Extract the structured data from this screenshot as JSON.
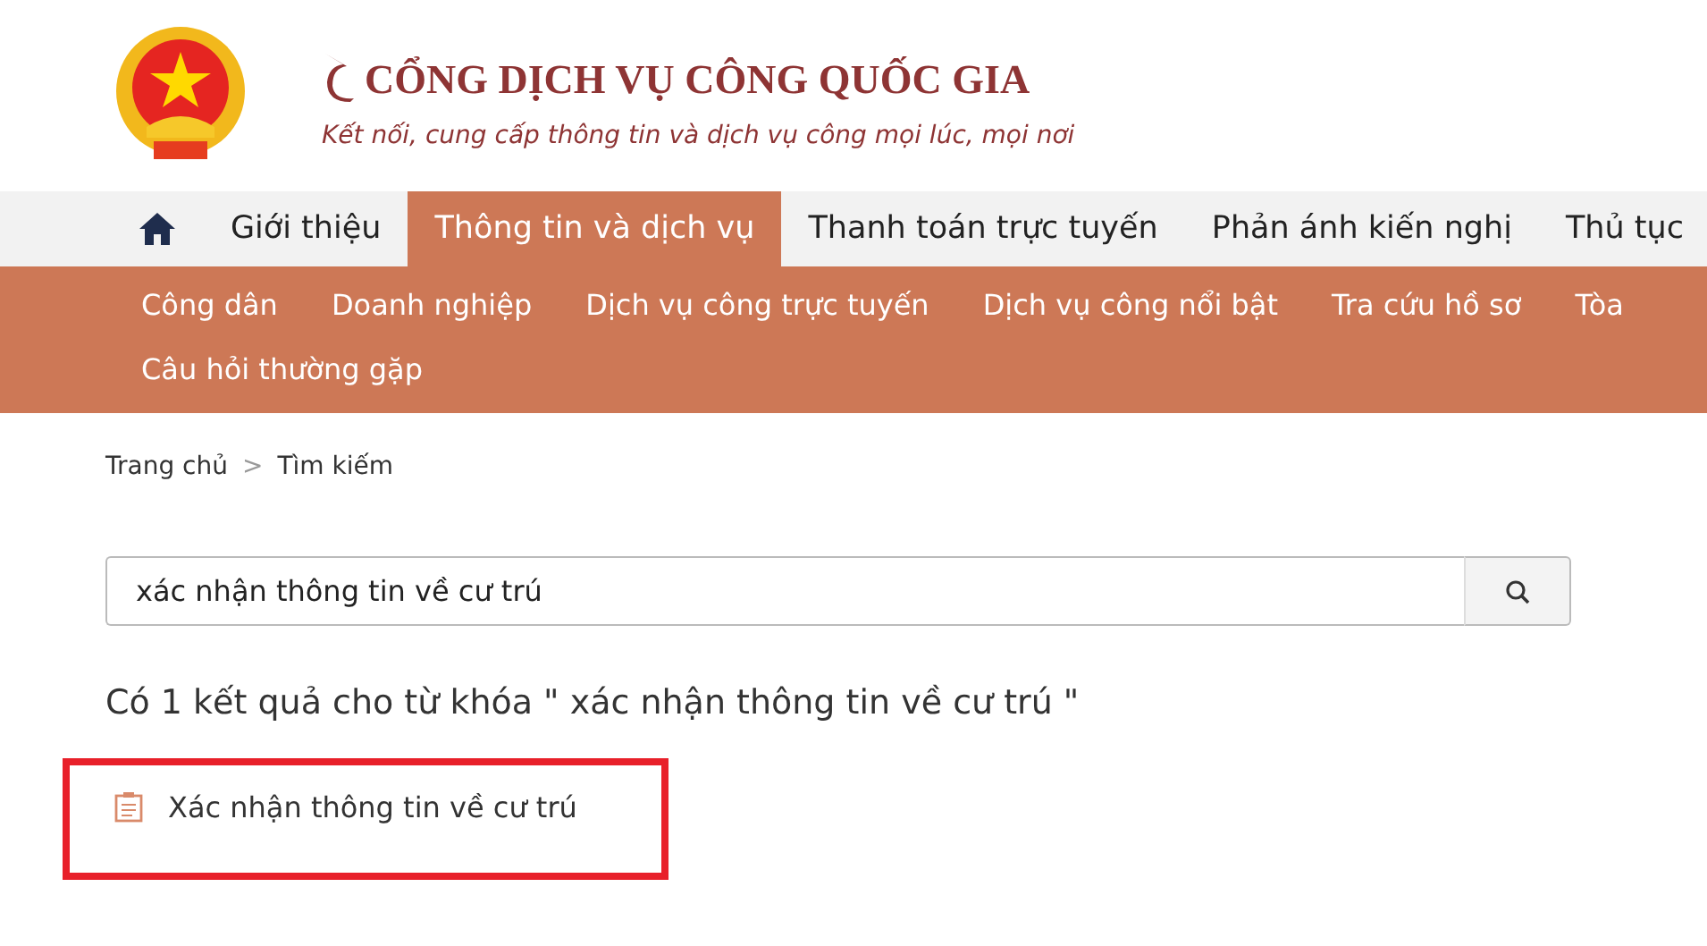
{
  "header": {
    "title": "CỔNG DỊCH VỤ CÔNG QUỐC GIA",
    "tagline": "Kết nối, cung cấp thông tin và dịch vụ công mọi lúc, mọi nơi"
  },
  "nav": [
    {
      "kind": "home",
      "selected": false
    },
    {
      "kind": "text",
      "label": "Giới thiệu",
      "selected": false
    },
    {
      "kind": "text",
      "label": "Thông tin và dịch vụ",
      "selected": true
    },
    {
      "kind": "text",
      "label": "Thanh toán trực tuyến",
      "selected": false
    },
    {
      "kind": "text",
      "label": "Phản ánh kiến nghị",
      "selected": false
    },
    {
      "kind": "text",
      "label": "Thủ tục",
      "selected": false
    }
  ],
  "sub_nav": [
    "Công dân",
    "Doanh nghiệp",
    "Dịch vụ công trực tuyến",
    "Dịch vụ công nổi bật",
    "Tra cứu hồ sơ",
    "Tòa",
    "Câu hỏi thường gặp"
  ],
  "breadcrumb": {
    "items": [
      "Trang chủ",
      "Tìm kiếm"
    ],
    "separator": ">"
  },
  "search": {
    "value": "xác nhận thông tin về cư trú"
  },
  "results_heading": "Có 1 kết quả cho từ khóa \" xác nhận thông tin về cư trú \"",
  "results": [
    {
      "title": "Xác nhận thông tin về cư trú",
      "highlighted": true
    }
  ]
}
